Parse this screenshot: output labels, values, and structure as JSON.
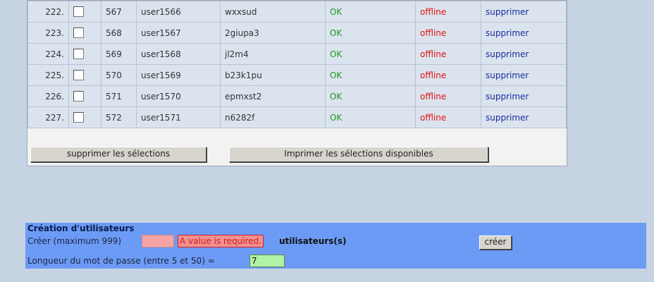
{
  "table": {
    "rows": [
      {
        "num": "222.",
        "id": "567",
        "user": "user1566",
        "password": "wxxsud",
        "status": "OK",
        "online": "offline",
        "action": "supprimer"
      },
      {
        "num": "223.",
        "id": "568",
        "user": "user1567",
        "password": "2giupa3",
        "status": "OK",
        "online": "offline",
        "action": "supprimer"
      },
      {
        "num": "224.",
        "id": "569",
        "user": "user1568",
        "password": "jl2m4",
        "status": "OK",
        "online": "offline",
        "action": "supprimer"
      },
      {
        "num": "225.",
        "id": "570",
        "user": "user1569",
        "password": "b23k1pu",
        "status": "OK",
        "online": "offline",
        "action": "supprimer"
      },
      {
        "num": "226.",
        "id": "571",
        "user": "user1570",
        "password": "epmxst2",
        "status": "OK",
        "online": "offline",
        "action": "supprimer"
      },
      {
        "num": "227.",
        "id": "572",
        "user": "user1571",
        "password": "n6282f",
        "status": "OK",
        "online": "offline",
        "action": "supprimer"
      }
    ],
    "delete_selected_label": "supprimer les sélections",
    "print_selected_label": "Imprimer les sélections disponibles"
  },
  "creation": {
    "title": "Création d'utilisateurs",
    "create_label": "Créer (maximum 999)",
    "create_value": "",
    "error_text": "A value is required.",
    "units_label": "utilisateurs(s)",
    "create_button": "créer",
    "length_label": "Longueur du mot de passe (entre 5 et 50) =",
    "length_value": "7"
  },
  "colors": {
    "background": "#c6d3e3",
    "panel": "#6c9bf5",
    "ok": "#1a9a1a",
    "offline": "#e01010",
    "link": "#1a2aa0",
    "error": "#d12020"
  }
}
